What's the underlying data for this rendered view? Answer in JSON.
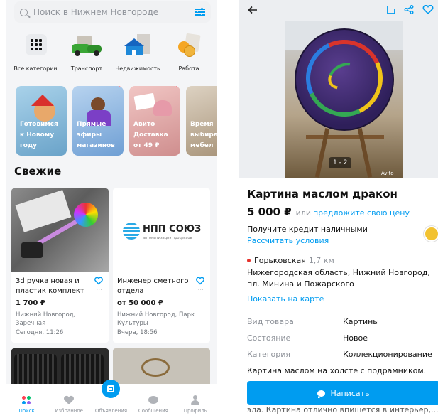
{
  "search": {
    "placeholder": "Поиск в Нижнем Новгороде",
    "icon": "search-icon",
    "filter_icon": "filter-icon"
  },
  "categories": [
    {
      "label": "Все категории",
      "icon": "grid-icon"
    },
    {
      "label": "Транспорт",
      "icon": "car-icon"
    },
    {
      "label": "Недвижимость",
      "icon": "house-icon"
    },
    {
      "label": "Работа",
      "icon": "briefcase-icon"
    }
  ],
  "stories": [
    {
      "text": [
        "Готовимся",
        "к Новому",
        "году"
      ],
      "color": "#7fb5d8"
    },
    {
      "text": [
        "Прямые",
        "эфиры",
        "магазинов"
      ],
      "color": "#8fb9e3"
    },
    {
      "text": [
        "Авито",
        "Доставка",
        "от 49 ₽"
      ],
      "color": "#e3a3a3"
    },
    {
      "text": [
        "Время",
        "выбира",
        "мебел"
      ],
      "color": "#c6b39a"
    }
  ],
  "fresh_title": "Свежие",
  "listings": [
    {
      "title": "3d ручка новая и пластик комплект",
      "price": "1 700 ₽",
      "location": "Нижний Новгород, Заречная",
      "date": "Сегодня, 11:26",
      "image_caption": ""
    },
    {
      "title": "Инженер сметного отдела",
      "price": "от 50 000 ₽",
      "location": "Нижний Новгород, Парк Культуры",
      "date": "Вчера, 18:56",
      "image_caption": "НПП СОЮЗ",
      "image_subcaption": "автоматизация процессов"
    }
  ],
  "more_glyph": "···",
  "tabs": [
    {
      "label": "Поиск",
      "icon": "search-icon",
      "active": true
    },
    {
      "label": "Избранное",
      "icon": "heart-icon",
      "active": false
    },
    {
      "label": "Объявления",
      "icon": "post-ad-icon",
      "active": false
    },
    {
      "label": "Сообщения",
      "icon": "chat-icon",
      "active": false
    },
    {
      "label": "Профиль",
      "icon": "profile-icon",
      "active": false
    }
  ],
  "ad": {
    "back_icon": "arrow-left-icon",
    "actions": [
      "bookmark-icon",
      "share-icon",
      "heart-icon"
    ],
    "photo_counter": "1 - 2",
    "watermark": "Avito",
    "title": "Картина маслом дракон",
    "price": "5 000 ₽",
    "or": "или",
    "offer_link": "предложите свою цену",
    "credit_text": "Получите кредит наличными",
    "credit_link": "Рассчитать условия",
    "metro": "Горьковская",
    "metro_distance": "1,7 км",
    "address": "Нижегородская область, Нижний Новгород, пл. Минина и Пожарского",
    "map_link": "Показать на карте",
    "params": [
      {
        "key": "Вид товара",
        "value": "Картины"
      },
      {
        "key": "Состояние",
        "value": "Новое"
      },
      {
        "key": "Категория",
        "value": "Коллекционирование"
      }
    ],
    "description": "Картина маслом на холсте с подрамником.",
    "description_cut": "эла. Картина отлично впишется в интерьер,...",
    "write_button": "Написать"
  },
  "colors": {
    "accent": "#009cf0",
    "metro": "#e5312b",
    "badge": "#f2c230"
  }
}
